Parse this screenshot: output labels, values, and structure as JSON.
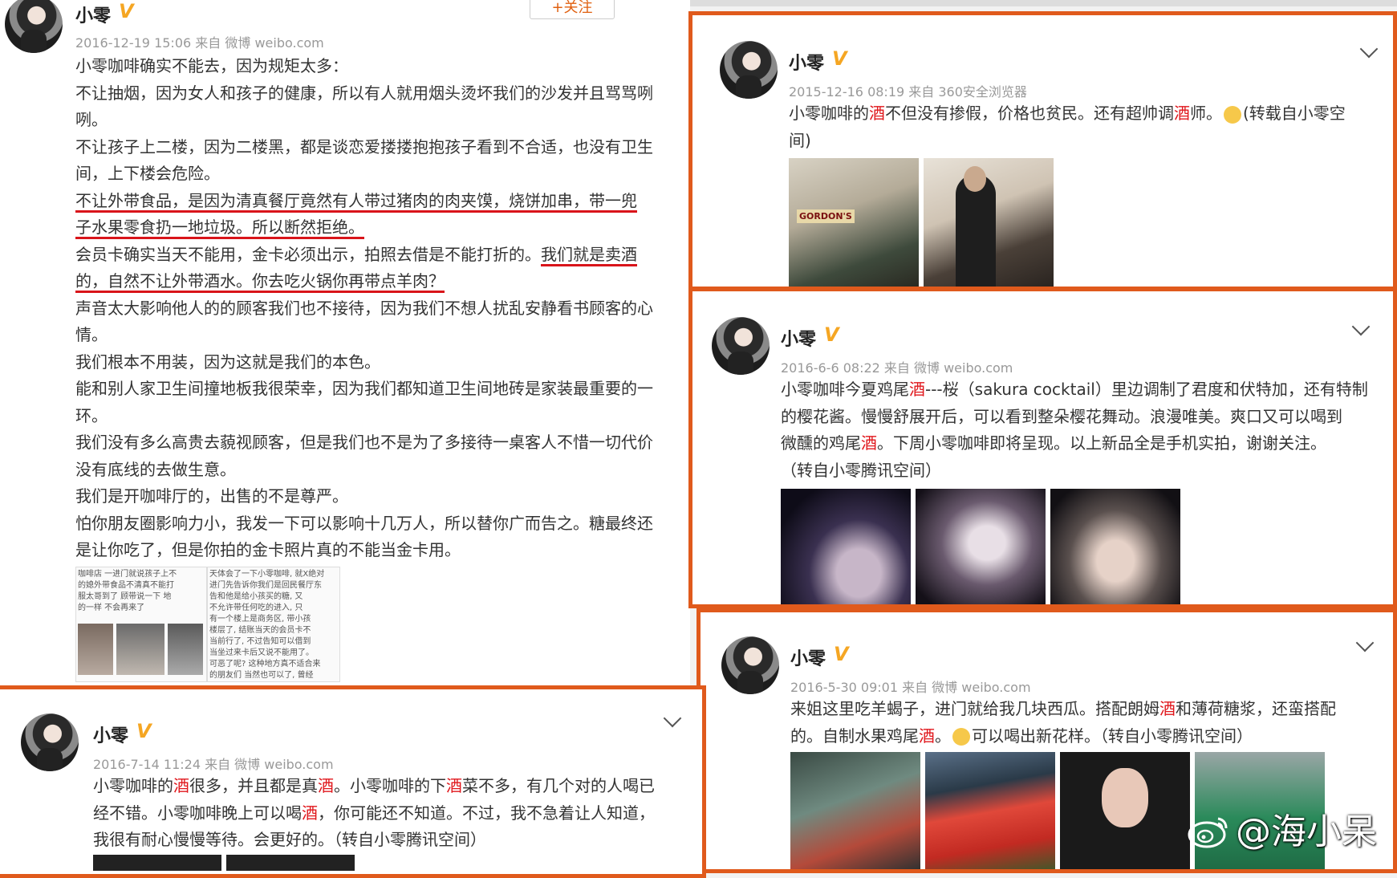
{
  "post_main": {
    "username": "小零",
    "verified_badge": "V",
    "follow_label": "+关注",
    "meta": "2016-12-19 15:06 来自 微博 weibo.com",
    "paragraphs": [
      "小零咖啡确实不能去，因为规矩太多：",
      "不让抽烟，因为女人和孩子的健康，所以有人就用烟头烫坏我们的沙发并且骂骂咧咧。",
      "不让孩子上二楼，因为二楼黑，都是谈恋爱搂搂抱抱孩子看到不合适，也没有卫生间，上下楼会危险。",
      "不让外带食品，是因为清真餐厅竟然有人带过猪肉的肉夹馍，烧饼加串，带一兜子水果零食扔一地垃圾。所以断然拒绝。",
      "会员卡确实当天不能用，金卡必须出示，拍照去借是不能打折的。我们就是卖酒的，自然不让外带酒水。你去吃火锅你再带点羊肉？",
      "声音太大影响他人的的顾客我们也不接待，因为我们不想人扰乱安静看书顾客的心情。",
      "我们根本不用装，因为这就是我们的本色。",
      "能和别人家卫生间撞地板我很荣幸，因为我们都知道卫生间地砖是家装最重要的一环。",
      "我们没有多么高贵去藐视顾客，但是我们也不是为了多接待一桌客人不惜一切代价没有底线的去做生意。",
      "我们是开咖啡厅的，出售的不是尊严。",
      "怕你朋友圈影响力小，我发一下可以影响十几万人，所以替你广而告之。糖最终还是让你吃了，但是你拍的金卡照片真的不能当金卡用。"
    ],
    "p4_before": "不让外带食品，是因为清真餐厅竟然有人带过猪肉的肉夹馍，烧饼加串，带一兜",
    "p4_after": "子水果零食扔一地垃圾。所以断然拒绝。",
    "p5_plain": "会员卡确实当天不能用，金卡必须出示，拍照去借是不能打折的。",
    "p5_under1": "我们就是卖酒",
    "p5_under2": "的，自然不让外带酒水。你去吃火锅你再带点羊肉？",
    "screenshot_text_left": "咖啡店 一进门就说孩子上不\n的媳外带食品不清真不能打\n服太哥到了 顾带说一下 地\n的一样 不会再来了",
    "screenshot_text_right": "天体会了一下小零咖啡, 就X绝对\n进门先告诉你我们是回民餐厅东\n告和他是给小孩买的糖, 又\n不允许带任何吃的进入, 只\n有一个楼上是商务区, 带小孩\n楼层了, 结账当天的会员卡不\n当前行了, 不过告知可以借到\n当坐过来卡后又说不能用了。\n可恶了呢? 这种地方真不适合来\n的朋友们 当然也可以了, 曾经"
  },
  "post_top_right": {
    "username": "小零",
    "verified_badge": "V",
    "meta": "2015-12-16 08:19 来自 360安全浏览器",
    "text_a": "小零咖啡的",
    "text_hl1": "酒",
    "text_b": "不但没有掺假，价格也贫民。还有超帅调",
    "text_hl2": "酒",
    "text_c": "师。",
    "text_d": "(转载自小零空",
    "text_e": "间)",
    "bottle_label": "GORDON'S"
  },
  "post_mid_right": {
    "username": "小零",
    "verified_badge": "V",
    "meta": "2016-6-6 08:22 来自 微博 weibo.com",
    "line1_a": "小零咖啡今夏鸡尾",
    "line1_hl": "酒",
    "line1_b": "---桜（sakura cocktail）里边调制了君度和伏特加，还有特制",
    "line2": "的樱花酱。慢慢舒展开后，可以看到整朵樱花舞动。浪漫唯美。爽口又可以喝到",
    "line3_a": "微醺的鸡尾",
    "line3_hl": "酒",
    "line3_b": "。下周小零咖啡即将呈现。以上新品全是手机实拍，谢谢关注。",
    "line4": "（转自小零腾讯空间）"
  },
  "post_bottom_right": {
    "username": "小零",
    "verified_badge": "V",
    "meta": "2016-5-30 09:01 来自 微博 weibo.com",
    "line1_a": "来姐这里吃羊蝎子，进门就给我几块西瓜。搭配朗姆",
    "line1_hl": "酒",
    "line1_b": "和薄荷糖浆，还蛮搭配",
    "line2_a": "的。自制水果鸡尾",
    "line2_hl": "酒",
    "line2_b": "。",
    "line2_c": "可以喝出新花样。（转自小零腾讯空间）"
  },
  "post_bottom_left": {
    "username": "小零",
    "verified_badge": "V",
    "meta": "2016-7-14 11:24 来自 微博 weibo.com",
    "l1_a": "小零咖啡的",
    "l1_hl1": "酒",
    "l1_b": "很多，并且都是真",
    "l1_hl2": "酒",
    "l1_c": "。小零咖啡的下",
    "l1_hl3": "酒",
    "l1_d": "菜不多，有几个对的人喝已",
    "l2_a": "经不错。小零咖啡晚上可以喝",
    "l2_hl": "酒",
    "l2_b": "，你可能还不知道。不过，我不急着让人知道，",
    "l3": "我很有耐心慢慢等待。会更好的。（转自小零腾讯空间）"
  },
  "watermark": "@海小呆",
  "colors": {
    "accent_border": "#e05a1c",
    "highlight": "#e0161b",
    "verified": "#f5a623"
  }
}
